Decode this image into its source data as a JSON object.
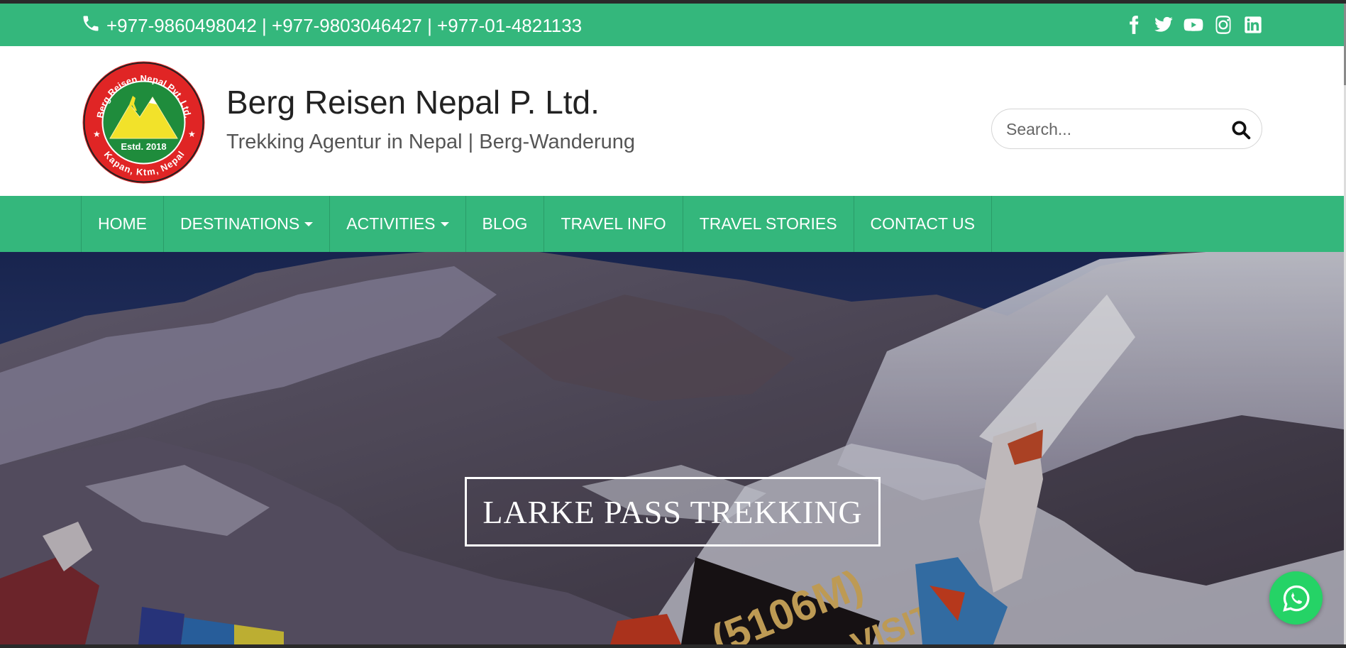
{
  "topbar": {
    "phones": "+977-9860498042 | +977-9803046427 | +977-01-4821133",
    "social": [
      "facebook-icon",
      "twitter-icon",
      "youtube-icon",
      "instagram-icon",
      "linkedin-icon"
    ]
  },
  "header": {
    "title": "Berg Reisen Nepal P. Ltd.",
    "tagline": "Trekking Agentur in Nepal | Berg-Wanderung",
    "logo": {
      "ring_top": "Berg Reisen Nepal Pvt. Ltd.",
      "ring_bottom": "Kapan, Ktm, Nepal",
      "established": "Estd. 2018"
    }
  },
  "search": {
    "placeholder": "Search...",
    "value": ""
  },
  "nav": {
    "items": [
      {
        "label": "HOME",
        "dropdown": false
      },
      {
        "label": "DESTINATIONS",
        "dropdown": true
      },
      {
        "label": "ACTIVITIES",
        "dropdown": true
      },
      {
        "label": "BLOG",
        "dropdown": false
      },
      {
        "label": "TRAVEL INFO",
        "dropdown": false
      },
      {
        "label": "TRAVEL STORIES",
        "dropdown": false
      },
      {
        "label": "CONTACT US",
        "dropdown": false
      }
    ]
  },
  "hero": {
    "caption": "LARKE PASS TREKKING",
    "sign_text": "(5106M)",
    "sign_text_2": "VISIT"
  },
  "colors": {
    "brand_green": "#34b77c",
    "whatsapp": "#25d366"
  }
}
